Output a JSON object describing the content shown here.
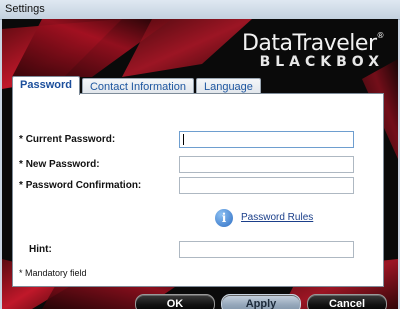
{
  "window": {
    "title": "Settings"
  },
  "brand": {
    "line1": "DataTraveler",
    "registered": "®",
    "line2": "BLACKBOX"
  },
  "tabs": [
    {
      "label": "Password",
      "active": true
    },
    {
      "label": "Contact Information",
      "active": false
    },
    {
      "label": "Language",
      "active": false
    }
  ],
  "form": {
    "current_password": {
      "label": "Current Password:",
      "required_marker": "*",
      "value": ""
    },
    "new_password": {
      "label": "New Password:",
      "required_marker": "*",
      "value": ""
    },
    "password_confirmation": {
      "label": "Password Confirmation:",
      "required_marker": "*",
      "value": ""
    },
    "hint": {
      "label": "Hint:",
      "value": ""
    }
  },
  "info": {
    "icon": "info-icon",
    "glyph": "i",
    "link_label": "Password Rules"
  },
  "mandatory_note": "* Mandatory field",
  "buttons": {
    "ok": "OK",
    "apply": "Apply",
    "cancel": "Cancel"
  },
  "colors": {
    "accent_red": "#b01020",
    "tab_text": "#1f57a0",
    "link": "#1b3f8a"
  }
}
